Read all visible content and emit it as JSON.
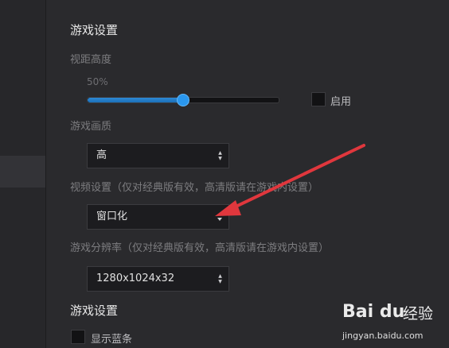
{
  "section1": {
    "title": "游戏设置"
  },
  "view_height": {
    "label": "视距高度",
    "value_text": "50%",
    "value_fraction": 0.5
  },
  "enable": {
    "label": "启用",
    "checked": false
  },
  "quality": {
    "label": "游戏画质",
    "value": "高"
  },
  "video": {
    "label": "视频设置（仅对经典版有效，高清版请在游戏内设置）",
    "value": "窗口化"
  },
  "resolution": {
    "label": "游戏分辨率（仅对经典版有效，高清版请在游戏内设置）",
    "value": "1280x1024x32"
  },
  "section2": {
    "title": "游戏设置"
  },
  "show_bar": {
    "label": "显示蓝条",
    "checked": false
  },
  "watermark": {
    "brand": "Bai du",
    "jingyan": "经验",
    "url": "jingyan.baidu.com"
  },
  "colors": {
    "accent": "#2a97ee",
    "annotation_arrow": "#e0373d",
    "background": "#2a2a2d"
  }
}
